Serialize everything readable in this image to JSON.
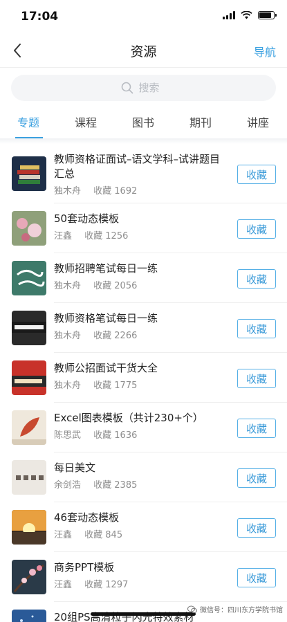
{
  "status": {
    "time": "17:04"
  },
  "nav": {
    "title": "资源",
    "right_link": "导航"
  },
  "search": {
    "placeholder": "搜索"
  },
  "tabs": [
    {
      "label": "专题"
    },
    {
      "label": "课程"
    },
    {
      "label": "图书"
    },
    {
      "label": "期刊"
    },
    {
      "label": "讲座"
    }
  ],
  "fav_prefix": "收藏",
  "fav_button_label": "收藏",
  "items": [
    {
      "title": "教师资格证面试–语文学科–试讲题目汇总",
      "author": "独木舟",
      "fav_count": "收藏 1692",
      "thumb_icon": "books-icon"
    },
    {
      "title": "50套动态模板",
      "author": "汪鑫",
      "fav_count": "收藏 1256",
      "thumb_icon": "flowers-icon"
    },
    {
      "title": "教师招聘笔试每日一练",
      "author": "独木舟",
      "fav_count": "收藏 2056",
      "thumb_icon": "chalkboard-icon"
    },
    {
      "title": "教师资格笔试每日一练",
      "author": "独木舟",
      "fav_count": "收藏 2266",
      "thumb_icon": "certificate-icon"
    },
    {
      "title": "教师公招面试干货大全",
      "author": "独木舟",
      "fav_count": "收藏 1775",
      "thumb_icon": "poster-icon"
    },
    {
      "title": "Excel图表模板（共计230+个）",
      "author": "陈思武",
      "fav_count": "收藏 1636",
      "thumb_icon": "leaf-icon"
    },
    {
      "title": "每日美文",
      "author": "余剑浩",
      "fav_count": "收藏 2385",
      "thumb_icon": "calligraphy-icon"
    },
    {
      "title": "46套动态模板",
      "author": "汪鑫",
      "fav_count": "收藏 845",
      "thumb_icon": "sunset-icon"
    },
    {
      "title": "商务PPT模板",
      "author": "汪鑫",
      "fav_count": "收藏 1297",
      "thumb_icon": "blossom-icon"
    },
    {
      "title": "20组PS高清粒子闪光特效素材",
      "author": "",
      "fav_count": "",
      "thumb_icon": "particles-icon"
    }
  ],
  "watermark": "微信号：四川东方学院书馆",
  "colors": {
    "accent": "#3aa0e0",
    "text": "#222222",
    "meta": "#8d8d8d"
  }
}
